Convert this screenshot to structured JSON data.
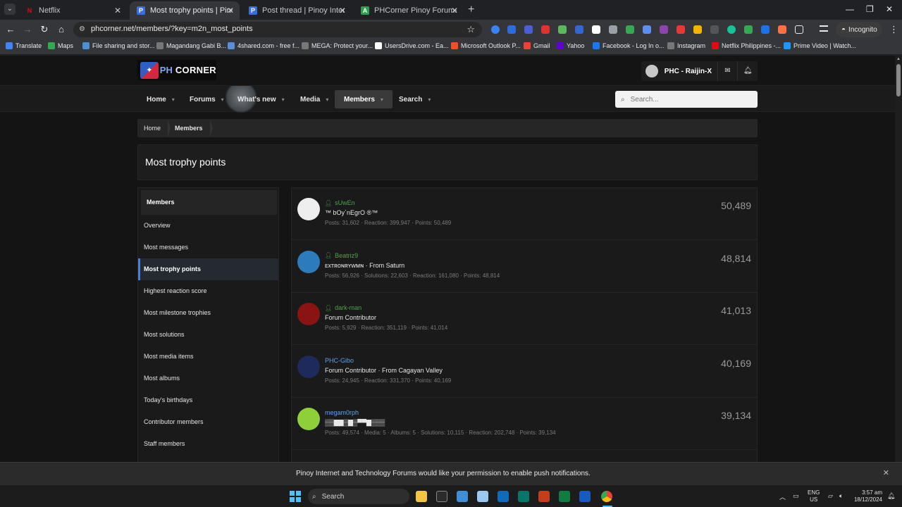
{
  "browser": {
    "tabs": [
      {
        "title": "Netflix",
        "favicon_color": "#e50914",
        "favicon": "N",
        "active": false
      },
      {
        "title": "Most trophy points | Pinoy Inte",
        "favicon_color": "#3b6fd6",
        "favicon": "P",
        "active": true
      },
      {
        "title": "Post thread | Pinoy Internet and",
        "favicon_color": "#3b6fd6",
        "favicon": "P",
        "active": false
      },
      {
        "title": "PHCorner Pinoy Forums APK (A",
        "favicon_color": "#2e9e4f",
        "favicon": "A",
        "active": false
      }
    ],
    "url": "phcorner.net/members/?key=m2n_most_points",
    "profile_label": "Incognito",
    "bookmarks": [
      {
        "label": "Translate",
        "color": "#4285f4"
      },
      {
        "label": "Maps",
        "color": "#34a853"
      },
      {
        "label": "File sharing and stor...",
        "color": "#4a90d9"
      },
      {
        "label": "Magandang Gabi B...",
        "color": "#777777"
      },
      {
        "label": "4shared.com - free f...",
        "color": "#5b8dd9"
      },
      {
        "label": "MEGA: Protect your...",
        "color": "#777777"
      },
      {
        "label": "UsersDrive.com - Ea...",
        "color": "#ffffff"
      },
      {
        "label": "Microsoft Outlook P...",
        "color": "#f25022"
      },
      {
        "label": "Gmail",
        "color": "#ea4335"
      },
      {
        "label": "Yahoo",
        "color": "#6001d2"
      },
      {
        "label": "Facebook - Log In o...",
        "color": "#1877f2"
      },
      {
        "label": "Instagram",
        "color": "#777777"
      },
      {
        "label": "Netflix Philippines -...",
        "color": "#e50914"
      },
      {
        "label": "Prime Video | Watch...",
        "color": "#1a98ff"
      }
    ]
  },
  "site": {
    "logo": {
      "ph": "PH",
      "corner": "CORNER"
    },
    "user": {
      "name": "PHC - Raijin-X"
    },
    "nav": [
      {
        "label": "Home",
        "active": false
      },
      {
        "label": "Forums",
        "active": false
      },
      {
        "label": "What's new",
        "active": false
      },
      {
        "label": "Media",
        "active": false
      },
      {
        "label": "Members",
        "active": true
      },
      {
        "label": "Search",
        "active": false
      }
    ],
    "search_placeholder": "Search...",
    "breadcrumb": [
      "Home",
      "Members"
    ],
    "page_title": "Most trophy points"
  },
  "sidebar": {
    "header": "Members",
    "items": [
      {
        "label": "Overview",
        "selected": false
      },
      {
        "label": "Most messages",
        "selected": false
      },
      {
        "label": "Most trophy points",
        "selected": true
      },
      {
        "label": "Highest reaction score",
        "selected": false
      },
      {
        "label": "Most milestone trophies",
        "selected": false
      },
      {
        "label": "Most solutions",
        "selected": false
      },
      {
        "label": "Most media items",
        "selected": false
      },
      {
        "label": "Most albums",
        "selected": false
      },
      {
        "label": "Today's birthdays",
        "selected": false
      },
      {
        "label": "Contributor members",
        "selected": false
      },
      {
        "label": "Staff members",
        "selected": false
      }
    ]
  },
  "members": [
    {
      "name": "sUwEn",
      "title": "™ bOy`nEgrO ®™",
      "stats": "Posts: 31,602 · Reaction: 399,947 · Points: 50,489",
      "points": "50,489",
      "name_color": "green",
      "avatar_color": "#eeeeee"
    },
    {
      "name": "Beatriz9",
      "title": "ᴇxᴛʀᴏɴʀʏᴡᴍɴ · From Saturn",
      "stats": "Posts: 56,926 · Solutions: 22,603 · Reaction: 161,080 · Points: 48,814",
      "points": "48,814",
      "name_color": "green",
      "avatar_color": "#2b7bbd"
    },
    {
      "name": "dark-man",
      "title": "Forum Contributor",
      "stats": "Posts: 5,929 · Reaction: 351,119 · Points: 41,014",
      "points": "41,013",
      "name_color": "green",
      "avatar_color": "#8a1414"
    },
    {
      "name": "PHC-Gibo",
      "title": "Forum Contributor · From Cagayan Valley",
      "stats": "Posts: 24,945 · Reaction: 331,370 · Points: 40,169",
      "points": "40,169",
      "name_color": "blue",
      "avatar_color": "#1f2a5c"
    },
    {
      "name": "megam0rph",
      "title": "▒▒▇▇▒▇▒▀▀▇▒▒▒",
      "stats": "Posts: 49,574 · Media: 5 · Albums: 5 · Solutions: 10,115 · Reaction: 202,748 · Points: 39,134",
      "points": "39,134",
      "name_color": "blue",
      "avatar_color": "#8fcf3a"
    }
  ],
  "notification": {
    "message": "Pinoy Internet and Technology Forums would like your permission to enable push notifications."
  },
  "taskbar": {
    "search_label": "Search",
    "lang_top": "ENG",
    "lang_bottom": "US",
    "time": "3:57 am",
    "date": "18/12/2024"
  }
}
